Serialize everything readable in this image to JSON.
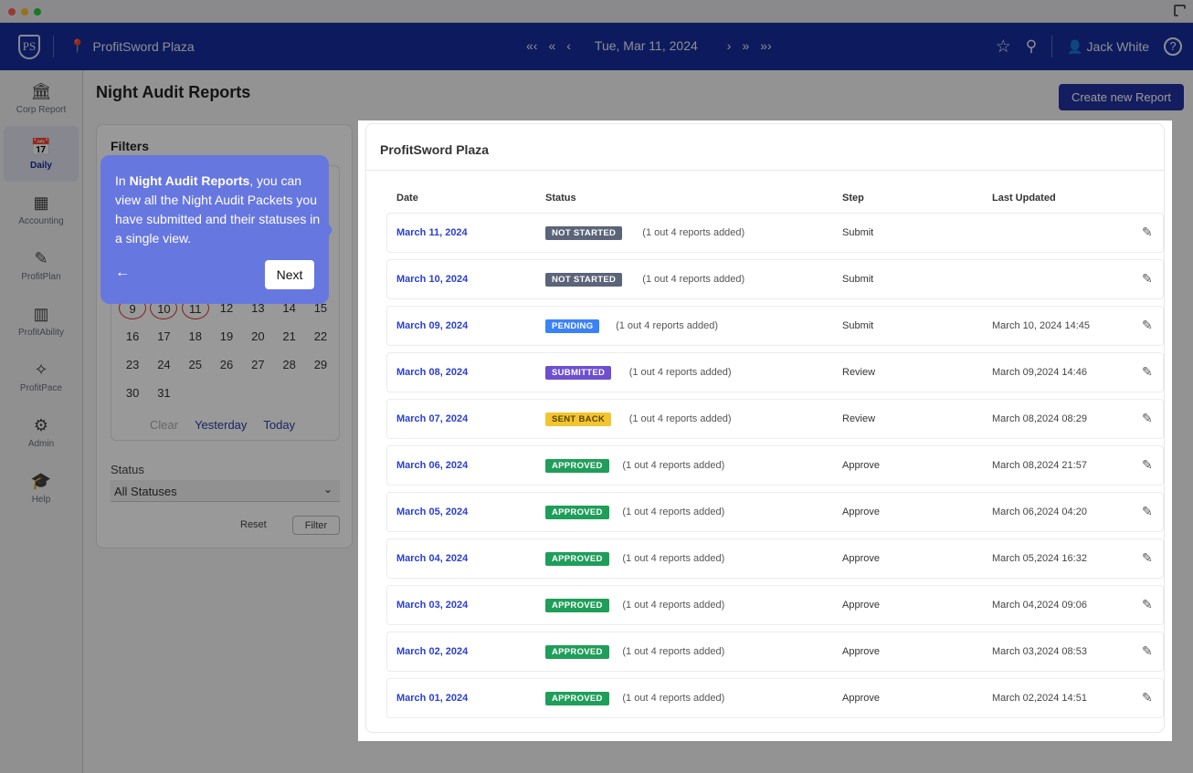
{
  "header": {
    "location": "ProfitSword Plaza",
    "date": "Tue, Mar 11, 2024",
    "nav_back": [
      "«‹",
      "«",
      "‹"
    ],
    "nav_fwd": [
      "›",
      "»",
      "»›"
    ],
    "user": "Jack White",
    "logo": "PS"
  },
  "sidebar": [
    {
      "label": "Corp Report",
      "icon": "🏛"
    },
    {
      "label": "Daily",
      "icon": "📅"
    },
    {
      "label": "Accounting",
      "icon": "▦"
    },
    {
      "label": "ProfitPlan",
      "icon": "✎"
    },
    {
      "label": "ProfitAbility",
      "icon": "▥"
    },
    {
      "label": "ProfitPace",
      "icon": "✧"
    },
    {
      "label": "Admin",
      "icon": "⚙"
    },
    {
      "label": "Help",
      "icon": "🎓"
    }
  ],
  "page": {
    "title": "Night Audit Reports",
    "create_label": "Create new Report"
  },
  "filters": {
    "title": "Filters",
    "days": [
      "9",
      "10",
      "11",
      "12",
      "13",
      "14",
      "15",
      "16",
      "17",
      "18",
      "19",
      "20",
      "21",
      "22",
      "23",
      "24",
      "25",
      "26",
      "27",
      "28",
      "29",
      "30",
      "31"
    ],
    "clear": "Clear",
    "yesterday": "Yesterday",
    "today": "Today",
    "status_label": "Status",
    "status_value": "All Statuses",
    "reset": "Reset",
    "filter": "Filter"
  },
  "tooltip": {
    "pre": "In ",
    "bold": "Night Audit Reports",
    "post": ", you can view all the Night Audit Packets you have submitted and their statuses in a single view.",
    "next": "Next"
  },
  "table": {
    "title": "ProfitSword Plaza",
    "headers": [
      "Date",
      "Status",
      "Step",
      "Last Updated"
    ],
    "colors": {
      "NOT STARTED": "#5b6478",
      "PENDING": "#3b82f6",
      "SUBMITTED": "#6d4fcf",
      "SENT BACK": "#f2c530",
      "APPROVED": "#1f9e5a"
    },
    "rows": [
      {
        "date": "March 11, 2024",
        "status": "NOT STARTED",
        "note": "(1 out 4 reports added)",
        "step": "Submit",
        "updated": ""
      },
      {
        "date": "March 10, 2024",
        "status": "NOT STARTED",
        "note": "(1 out 4 reports added)",
        "step": "Submit",
        "updated": ""
      },
      {
        "date": "March 09, 2024",
        "status": "PENDING",
        "note": "(1 out 4 reports added)",
        "step": "Submit",
        "updated": "March 10, 2024 14:45"
      },
      {
        "date": "March 08, 2024",
        "status": "SUBMITTED",
        "note": "(1 out 4 reports added)",
        "step": "Review",
        "updated": "March 09,2024 14:46"
      },
      {
        "date": "March 07, 2024",
        "status": "SENT BACK",
        "note": "(1 out 4 reports added)",
        "step": "Review",
        "updated": "March 08,2024 08:29"
      },
      {
        "date": "March 06, 2024",
        "status": "APPROVED",
        "note": "(1 out 4 reports added)",
        "step": "Approve",
        "updated": "March 08,2024 21:57"
      },
      {
        "date": "March 05, 2024",
        "status": "APPROVED",
        "note": "(1 out 4 reports added)",
        "step": "Approve",
        "updated": "March 06,2024 04:20"
      },
      {
        "date": "March 04, 2024",
        "status": "APPROVED",
        "note": "(1 out 4 reports added)",
        "step": "Approve",
        "updated": "March 05,2024 16:32"
      },
      {
        "date": "March 03, 2024",
        "status": "APPROVED",
        "note": "(1 out 4 reports added)",
        "step": "Approve",
        "updated": "March 04,2024 09:06"
      },
      {
        "date": "March 02, 2024",
        "status": "APPROVED",
        "note": "(1 out 4 reports added)",
        "step": "Approve",
        "updated": "March 03,2024 08:53"
      },
      {
        "date": "March 01, 2024",
        "status": "APPROVED",
        "note": "(1 out 4 reports added)",
        "step": "Approve",
        "updated": "March 02,2024 14:51"
      }
    ]
  }
}
